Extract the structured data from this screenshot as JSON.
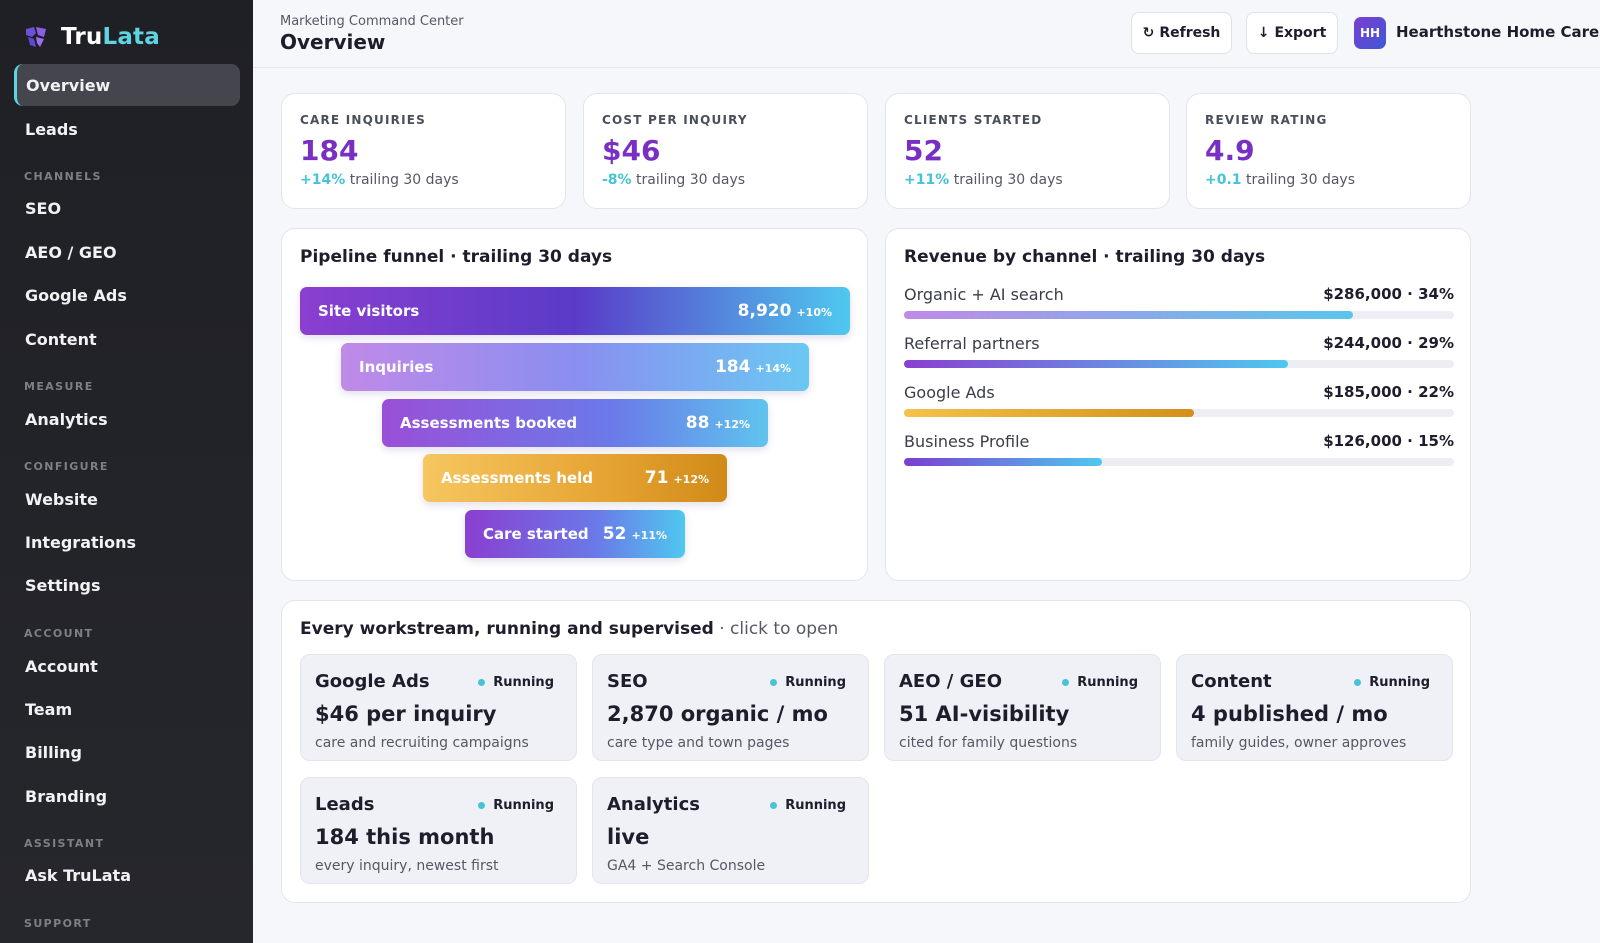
{
  "brand": {
    "name_a": "Tru",
    "name_b": "Lata"
  },
  "nav": {
    "overview": "Overview",
    "leads": "Leads",
    "channels_section": "CHANNELS",
    "seo": "SEO",
    "aeo": "AEO / GEO",
    "google_ads": "Google Ads",
    "content": "Content",
    "measure_section": "MEASURE",
    "analytics": "Analytics",
    "configure_section": "CONFIGURE",
    "website": "Website",
    "integrations": "Integrations",
    "settings": "Settings",
    "account_section": "ACCOUNT",
    "account": "Account",
    "team": "Team",
    "billing": "Billing",
    "branding": "Branding",
    "assistant_section": "ASSISTANT",
    "ask": "Ask TruLata",
    "support_section": "SUPPORT"
  },
  "header": {
    "crumb": "Marketing Command Center",
    "title": "Overview",
    "refresh": "Refresh",
    "export": "Export",
    "avatar": "HH",
    "org": "Hearthstone Home Care"
  },
  "kpis": [
    {
      "label": "CARE INQUIRIES",
      "value": "184",
      "delta": "+14%",
      "period": " trailing 30 days"
    },
    {
      "label": "COST PER INQUIRY",
      "value": "$46",
      "delta": "-8%",
      "period": " trailing 30 days"
    },
    {
      "label": "CLIENTS STARTED",
      "value": "52",
      "delta": "+11%",
      "period": " trailing 30 days"
    },
    {
      "label": "REVIEW RATING",
      "value": "4.9",
      "delta": "+0.1",
      "period": " trailing 30 days"
    }
  ],
  "funnel": {
    "title": "Pipeline funnel · trailing 30 days",
    "stages": [
      {
        "label": "Site visitors",
        "value": "8,920",
        "delta": "+10%"
      },
      {
        "label": "Inquiries",
        "value": "184",
        "delta": "+14%"
      },
      {
        "label": "Assessments booked",
        "value": "88",
        "delta": "+12%"
      },
      {
        "label": "Assessments held",
        "value": "71",
        "delta": "+12%"
      },
      {
        "label": "Care started",
        "value": "52",
        "delta": "+11%"
      }
    ]
  },
  "revenue": {
    "title": "Revenue by channel · trailing 30 days",
    "rows": [
      {
        "name": "Organic + AI search",
        "value": "$286,000 · 34%",
        "fill": 0.816,
        "color_from": "#c08ae8",
        "color_to": "#58c6ec"
      },
      {
        "name": "Referral partners",
        "value": "$244,000 · 29%",
        "fill": 0.698,
        "color_from": "#8a3fd0",
        "color_to": "#4fc8ef"
      },
      {
        "name": "Google Ads",
        "value": "$185,000 · 22%",
        "fill": 0.527,
        "color_from": "#f4c24a",
        "color_to": "#d4901c"
      },
      {
        "name": "Business Profile",
        "value": "$126,000 · 15%",
        "fill": 0.36,
        "color_from": "#7a3fd0",
        "color_to": "#4fc8ef"
      }
    ]
  },
  "workstreams": {
    "title": "Every workstream, running and supervised",
    "hint": " · click to open",
    "items": [
      {
        "name": "Google Ads",
        "status": "Running",
        "metric": "$46 per inquiry",
        "desc": "care and recruiting campaigns"
      },
      {
        "name": "SEO",
        "status": "Running",
        "metric": "2,870 organic / mo",
        "desc": "care type and town pages"
      },
      {
        "name": "AEO / GEO",
        "status": "Running",
        "metric": "51 AI-visibility",
        "desc": "cited for family questions"
      },
      {
        "name": "Content",
        "status": "Running",
        "metric": "4 published / mo",
        "desc": "family guides, owner approves"
      },
      {
        "name": "Leads",
        "status": "Running",
        "metric": "184 this month",
        "desc": "every inquiry, newest first"
      },
      {
        "name": "Analytics",
        "status": "Running",
        "metric": "live",
        "desc": "GA4 + Search Console"
      }
    ]
  },
  "colors": {
    "accent": "#7a2fc4",
    "teal": "#46c3d6",
    "sidebar": "#222328"
  }
}
